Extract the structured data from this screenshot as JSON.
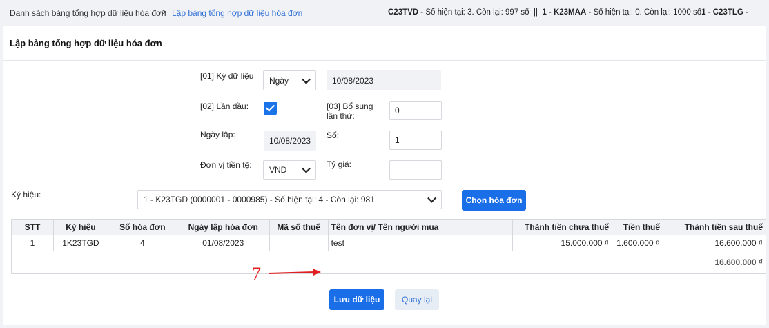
{
  "breadcrumb": {
    "item1": "Danh sách bảng tổng hợp dữ liệu hóa đơn",
    "separator": ">",
    "item2": "Lập bảng tổng hợp dữ liệu hóa đơn"
  },
  "serial_status": {
    "s1_code": "C23TVD",
    "s1_text": " - Số hiện tại: 3. Còn lại: 997 số",
    "divider": "||",
    "s2_code": "1 - K23MAA",
    "s2_text": " - Số hiện tại: 0. Còn lại: 1000 số",
    "s3_code": "1 - C23TLG",
    "s3_text": " -"
  },
  "page_title": "Lập bảng tổng hợp dữ liệu hóa đơn",
  "form": {
    "period_label": "[01] Kỳ dữ liệu",
    "period_type": "Ngày",
    "period_date": "10/08/2023",
    "first_time_label": "[02] Lần đầu:",
    "first_time_checked": true,
    "supplement_label": "[03] Bổ sung lần thứ:",
    "supplement_value": "0",
    "created_date_label": "Ngày lập:",
    "created_date": "10/08/2023",
    "number_label": "Số:",
    "number_value": "1",
    "currency_label": "Đơn vị tiền tệ:",
    "currency_value": "VND",
    "exchange_rate_label": "Tỷ giá:",
    "exchange_rate_value": "",
    "symbol_label": "Ký hiệu:",
    "symbol_value": "1 - K23TGD (0000001 - 0000985) - Số hiện tại: 4 - Còn lại: 981",
    "choose_invoice_button": "Chọn hóa đơn"
  },
  "table": {
    "headers": [
      "STT",
      "Ký hiệu",
      "Số hóa đơn",
      "Ngày lập hóa đơn",
      "Mã số thuế",
      "Tên đơn vị/ Tên người mua",
      "Thành tiền chưa thuế",
      "Tiền thuế",
      "Thành tiền sau thuế"
    ],
    "rows": [
      [
        "1",
        "1K23TGD",
        "4",
        "01/08/2023",
        "",
        "test",
        "15.000.000 ₫",
        "1.600.000 ₫",
        "16.600.000 ₫"
      ]
    ],
    "total_after_tax": "16.600.000 ₫"
  },
  "actions": {
    "save_button": "Lưu dữ liệu",
    "back_button": "Quay lại"
  },
  "annotation": {
    "step_number": "7",
    "color": "#e02020"
  },
  "colors": {
    "primary": "#1a6fe8",
    "link": "#2f6fd6",
    "background": "#f0f2f5"
  }
}
